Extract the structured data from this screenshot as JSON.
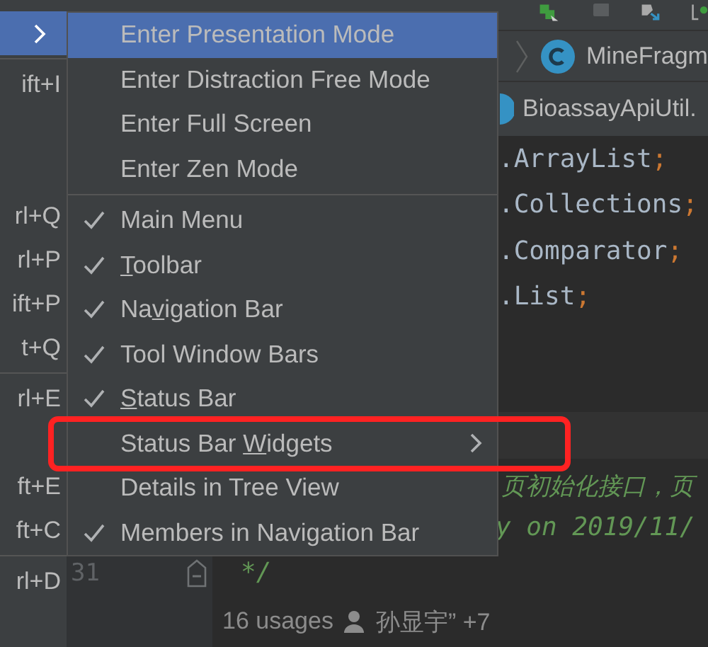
{
  "parent_menu": {
    "items": [
      {
        "kind": "item",
        "selected": true,
        "has_submenu": true
      },
      {
        "kind": "separator"
      },
      {
        "kind": "item",
        "shortcut": "ift+I",
        "selected": false,
        "has_submenu": false
      },
      {
        "kind": "blank"
      },
      {
        "kind": "blank"
      },
      {
        "kind": "item",
        "shortcut": "rl+Q",
        "selected": false,
        "has_submenu": false
      },
      {
        "kind": "item",
        "shortcut": "rl+P",
        "selected": false,
        "has_submenu": false
      },
      {
        "kind": "item",
        "shortcut": "ift+P",
        "selected": false,
        "has_submenu": false
      },
      {
        "kind": "item",
        "shortcut": "t+Q",
        "selected": false,
        "has_submenu": false
      },
      {
        "kind": "separator"
      },
      {
        "kind": "item",
        "shortcut": "rl+E",
        "selected": false,
        "has_submenu": false
      },
      {
        "kind": "blank"
      },
      {
        "kind": "item",
        "shortcut": "ft+E",
        "selected": false,
        "has_submenu": false
      },
      {
        "kind": "item",
        "shortcut": "ft+C",
        "selected": false,
        "has_submenu": false
      },
      {
        "kind": "separator"
      },
      {
        "kind": "item",
        "shortcut": "rl+D",
        "selected": false,
        "has_submenu": false
      }
    ]
  },
  "submenu": {
    "items": [
      {
        "kind": "item",
        "label": [
          "Enter Presentation Mode"
        ],
        "checked": false,
        "selected": true,
        "has_submenu": false
      },
      {
        "kind": "item",
        "label": [
          "Enter Distraction Free Mode"
        ],
        "checked": false,
        "selected": false,
        "has_submenu": false
      },
      {
        "kind": "item",
        "label": [
          "Enter Full Screen"
        ],
        "checked": false,
        "selected": false,
        "has_submenu": false
      },
      {
        "kind": "item",
        "label": [
          "Enter Zen Mode"
        ],
        "checked": false,
        "selected": false,
        "has_submenu": false
      },
      {
        "kind": "separator"
      },
      {
        "kind": "item",
        "label": [
          "Main Menu"
        ],
        "checked": true,
        "selected": false,
        "has_submenu": false
      },
      {
        "kind": "item",
        "mnemonic_label": {
          "key": "T",
          "after": "oolbar"
        },
        "checked": true,
        "selected": false,
        "has_submenu": false
      },
      {
        "kind": "item",
        "mnemonic_label": {
          "before": "Na",
          "key": "v",
          "after": "igation Bar"
        },
        "checked": true,
        "selected": false,
        "has_submenu": false
      },
      {
        "kind": "item",
        "label": [
          "Tool Window Bars"
        ],
        "checked": true,
        "selected": false,
        "has_submenu": false
      },
      {
        "kind": "item",
        "mnemonic_label": {
          "key": "S",
          "after": "tatus Bar"
        },
        "checked": true,
        "selected": false,
        "has_submenu": false
      },
      {
        "kind": "item",
        "mnemonic_label": {
          "before": "Status Bar ",
          "key": "W",
          "after": "idgets"
        },
        "checked": false,
        "selected": false,
        "has_submenu": true,
        "outlined": true
      },
      {
        "kind": "item",
        "label": [
          "Details in Tree View"
        ],
        "checked": false,
        "selected": false,
        "has_submenu": false
      },
      {
        "kind": "item",
        "label": [
          "Members in Navigation Bar"
        ],
        "checked": true,
        "selected": false,
        "has_submenu": false
      }
    ]
  },
  "breadcrumb": {
    "class_name": "MineFragm"
  },
  "tab": {
    "title": "BioassayApiUtil."
  },
  "editor": {
    "lines": [
      {
        "kind": "code",
        "text": ".ArrayList",
        "end": ";"
      },
      {
        "kind": "code",
        "text": ".Collections",
        "end": ";"
      },
      {
        "kind": "code",
        "text": ".Comparator",
        "end": ";"
      },
      {
        "kind": "code",
        "text": ".List",
        "end": ";"
      },
      {
        "kind": "blank"
      },
      {
        "kind": "blank"
      },
      {
        "kind": "current"
      },
      {
        "kind": "comment_cjk",
        "text": "页初始化接口，页"
      },
      {
        "kind": "comment",
        "text": "y on 2019/11/"
      },
      {
        "kind": "comment_end",
        "number": "31",
        "text": "*/"
      },
      {
        "kind": "usages",
        "text": "16 usages",
        "author": "孙显宇” +7"
      }
    ]
  }
}
